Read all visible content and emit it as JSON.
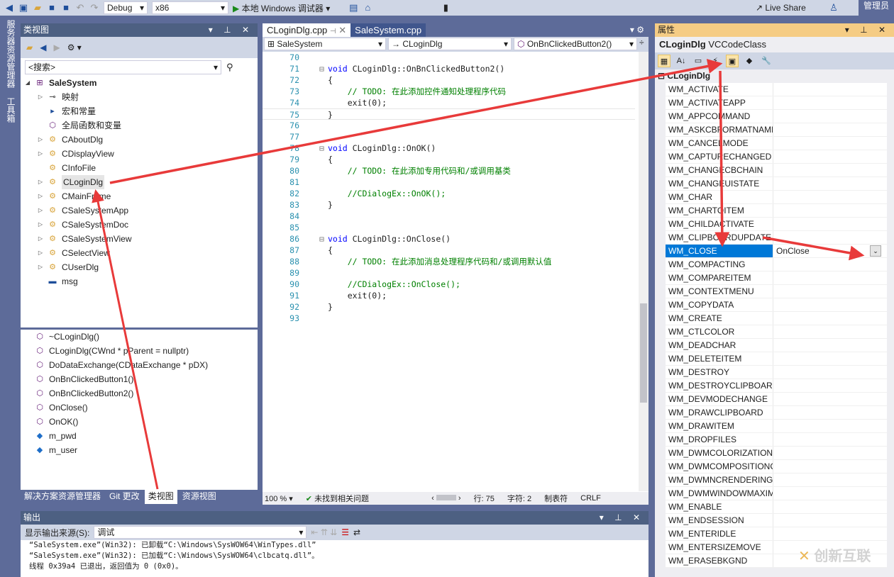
{
  "toolbar": {
    "config": "Debug",
    "platform": "x86",
    "run": "本地 Windows 调试器",
    "live_share": "Live Share",
    "user": "管理员"
  },
  "left_strip": {
    "server_explorer": "服务器资源管理器",
    "toolbox": "工具箱"
  },
  "class_view": {
    "title": "类视图",
    "search_placeholder": "<搜索>",
    "root": "SaleSystem",
    "items": [
      {
        "label": "映射",
        "icon": "map-icon",
        "expand": true
      },
      {
        "label": "宏和常量",
        "icon": "macro-icon",
        "expand": false
      },
      {
        "label": "全局函数和变量",
        "icon": "global-icon",
        "expand": false
      },
      {
        "label": "CAboutDlg",
        "icon": "class-icon",
        "expand": true
      },
      {
        "label": "CDisplayView",
        "icon": "class-icon",
        "expand": true
      },
      {
        "label": "CInfoFile",
        "icon": "class-icon",
        "expand": false
      },
      {
        "label": "CLoginDlg",
        "icon": "class-icon",
        "expand": true,
        "selected": true
      },
      {
        "label": "CMainFrame",
        "icon": "class-icon",
        "expand": true
      },
      {
        "label": "CSaleSystemApp",
        "icon": "class-icon",
        "expand": true
      },
      {
        "label": "CSaleSystemDoc",
        "icon": "class-icon",
        "expand": true
      },
      {
        "label": "CSaleSystemView",
        "icon": "class-icon",
        "expand": true
      },
      {
        "label": "CSelectView",
        "icon": "class-icon",
        "expand": true
      },
      {
        "label": "CUserDlg",
        "icon": "class-icon",
        "expand": true
      },
      {
        "label": "msg",
        "icon": "struct-icon",
        "expand": false
      }
    ],
    "members": [
      "~CLoginDlg()",
      "CLoginDlg(CWnd * pParent = nullptr)",
      "DoDataExchange(CDataExchange * pDX)",
      "OnBnClickedButton1()",
      "OnBnClickedButton2()",
      "OnClose()",
      "OnOK()",
      "m_pwd",
      "m_user"
    ],
    "tabs": [
      "解决方案资源管理器",
      "Git 更改",
      "类视图",
      "资源视图"
    ]
  },
  "editor": {
    "tabs": [
      "CLoginDlg.cpp",
      "SaleSystem.cpp"
    ],
    "nav": [
      "SaleSystem",
      "CLoginDlg",
      "OnBnClickedButton2()"
    ],
    "lines": [
      {
        "n": "70",
        "t": ""
      },
      {
        "n": "71",
        "t": "void CLoginDlg::OnBnClickedButton2()",
        "fold": true
      },
      {
        "n": "72",
        "t": "{"
      },
      {
        "n": "73",
        "t": "    // TODO: 在此添加控件通知处理程序代码",
        "c": true
      },
      {
        "n": "74",
        "t": "    exit(0);"
      },
      {
        "n": "75",
        "t": "}"
      },
      {
        "n": "76",
        "t": ""
      },
      {
        "n": "77",
        "t": ""
      },
      {
        "n": "78",
        "t": "void CLoginDlg::OnOK()",
        "fold": true
      },
      {
        "n": "79",
        "t": "{"
      },
      {
        "n": "80",
        "t": "    // TODO: 在此添加专用代码和/或调用基类",
        "c": true
      },
      {
        "n": "81",
        "t": ""
      },
      {
        "n": "82",
        "t": "    //CDialogEx::OnOK();",
        "c": true
      },
      {
        "n": "83",
        "t": "}"
      },
      {
        "n": "84",
        "t": ""
      },
      {
        "n": "85",
        "t": ""
      },
      {
        "n": "86",
        "t": "void CLoginDlg::OnClose()",
        "fold": true
      },
      {
        "n": "87",
        "t": "{"
      },
      {
        "n": "88",
        "t": "    // TODO: 在此添加消息处理程序代码和/或调用默认值",
        "c": true
      },
      {
        "n": "89",
        "t": ""
      },
      {
        "n": "90",
        "t": "    //CDialogEx::OnClose();",
        "c": true
      },
      {
        "n": "91",
        "t": "    exit(0);"
      },
      {
        "n": "92",
        "t": "}"
      },
      {
        "n": "93",
        "t": ""
      }
    ],
    "status": {
      "zoom": "100 %",
      "issues": "未找到相关问题",
      "line": "行: 75",
      "col": "字符: 2",
      "indent": "制表符",
      "eol": "CRLF"
    }
  },
  "output": {
    "title": "输出",
    "source_label": "显示输出来源(S):",
    "source": "调试",
    "lines": [
      "“SaleSystem.exe”(Win32): 已卸载“C:\\Windows\\SysWOW64\\WinTypes.dll”",
      "“SaleSystem.exe”(Win32): 已加载“C:\\Windows\\SysWOW64\\clbcatq.dll”。",
      "线程 0x39a4 已退出，返回值为 0 (0x0)。"
    ]
  },
  "properties": {
    "title": "属性",
    "object": "CLoginDlg",
    "object_type": "VCCodeClass",
    "group": "CLoginDlg",
    "rows": [
      {
        "name": "WM_ACTIVATE",
        "value": ""
      },
      {
        "name": "WM_ACTIVATEAPP",
        "value": ""
      },
      {
        "name": "WM_APPCOMMAND",
        "value": ""
      },
      {
        "name": "WM_ASKCBFORMATNAME",
        "value": ""
      },
      {
        "name": "WM_CANCELMODE",
        "value": ""
      },
      {
        "name": "WM_CAPTURECHANGED",
        "value": ""
      },
      {
        "name": "WM_CHANGECBCHAIN",
        "value": ""
      },
      {
        "name": "WM_CHANGEUISTATE",
        "value": ""
      },
      {
        "name": "WM_CHAR",
        "value": ""
      },
      {
        "name": "WM_CHARTOITEM",
        "value": ""
      },
      {
        "name": "WM_CHILDACTIVATE",
        "value": ""
      },
      {
        "name": "WM_CLIPBOARDUPDATE",
        "value": ""
      },
      {
        "name": "WM_CLOSE",
        "value": "OnClose",
        "selected": true
      },
      {
        "name": "WM_COMPACTING",
        "value": ""
      },
      {
        "name": "WM_COMPAREITEM",
        "value": ""
      },
      {
        "name": "WM_CONTEXTMENU",
        "value": ""
      },
      {
        "name": "WM_COPYDATA",
        "value": ""
      },
      {
        "name": "WM_CREATE",
        "value": ""
      },
      {
        "name": "WM_CTLCOLOR",
        "value": ""
      },
      {
        "name": "WM_DEADCHAR",
        "value": ""
      },
      {
        "name": "WM_DELETEITEM",
        "value": ""
      },
      {
        "name": "WM_DESTROY",
        "value": ""
      },
      {
        "name": "WM_DESTROYCLIPBOARD",
        "value": ""
      },
      {
        "name": "WM_DEVMODECHANGE",
        "value": ""
      },
      {
        "name": "WM_DRAWCLIPBOARD",
        "value": ""
      },
      {
        "name": "WM_DRAWITEM",
        "value": ""
      },
      {
        "name": "WM_DROPFILES",
        "value": ""
      },
      {
        "name": "WM_DWMCOLORIZATIONCOLORCHANGED",
        "value": ""
      },
      {
        "name": "WM_DWMCOMPOSITIONCHANGED",
        "value": ""
      },
      {
        "name": "WM_DWMNCRENDERINGCHANGED",
        "value": ""
      },
      {
        "name": "WM_DWMWINDOWMAXIMIZEDCHANGE",
        "value": ""
      },
      {
        "name": "WM_ENABLE",
        "value": ""
      },
      {
        "name": "WM_ENDSESSION",
        "value": ""
      },
      {
        "name": "WM_ENTERIDLE",
        "value": ""
      },
      {
        "name": "WM_ENTERSIZEMOVE",
        "value": ""
      },
      {
        "name": "WM_ERASEBKGND",
        "value": ""
      }
    ]
  },
  "watermark": "创新互联",
  "colors": {
    "accent": "#0078d7",
    "annotation": "#e83a3a",
    "panel_header": "#4d6082",
    "properties_header": "#f5cc84"
  }
}
